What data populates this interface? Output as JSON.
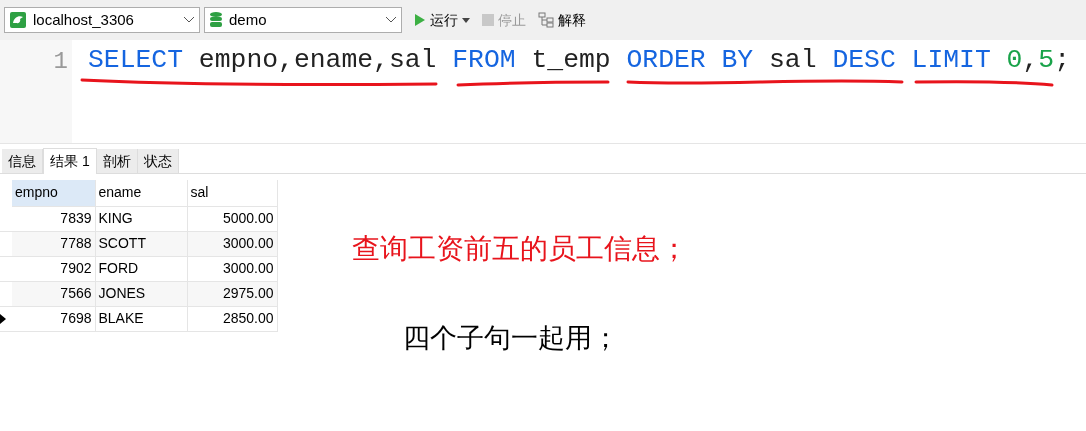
{
  "toolbar": {
    "connection": "localhost_3306",
    "database": "demo",
    "buttons": [
      {
        "label": "运行",
        "disabled": false,
        "kind": "run"
      },
      {
        "label": "停止",
        "disabled": true,
        "kind": "stop"
      },
      {
        "label": "解释",
        "disabled": false,
        "kind": "explain"
      }
    ]
  },
  "editor": {
    "line_number": "1",
    "tokens": [
      {
        "text": "SELECT",
        "kind": "keyword"
      },
      {
        "text": " empno,ename,sal ",
        "kind": "plain"
      },
      {
        "text": "FROM",
        "kind": "keyword"
      },
      {
        "text": " t_emp ",
        "kind": "plain"
      },
      {
        "text": "ORDER",
        "kind": "keyword"
      },
      {
        "text": " BY",
        "kind": "keyword"
      },
      {
        "text": " sal ",
        "kind": "plain"
      },
      {
        "text": "DESC",
        "kind": "keyword"
      },
      {
        "text": " LIMIT",
        "kind": "keyword"
      },
      {
        "text": " 0",
        "kind": "number"
      },
      {
        "text": ",",
        "kind": "plain"
      },
      {
        "text": "5",
        "kind": "number"
      },
      {
        "text": ";",
        "kind": "plain"
      }
    ]
  },
  "tabs": [
    {
      "label": "信息",
      "selected": false
    },
    {
      "label": "结果 1",
      "selected": true
    },
    {
      "label": "剖析",
      "selected": false
    },
    {
      "label": "状态",
      "selected": false
    }
  ],
  "table": {
    "columns": [
      {
        "label": "empno",
        "selected": true
      },
      {
        "label": "ename",
        "selected": false
      },
      {
        "label": "sal",
        "selected": false
      }
    ],
    "rows": [
      {
        "cells": [
          "7839",
          "KING",
          "5000.00"
        ],
        "current": false
      },
      {
        "cells": [
          "7788",
          "SCOTT",
          "3000.00"
        ],
        "current": false
      },
      {
        "cells": [
          "7902",
          "FORD",
          "3000.00"
        ],
        "current": false
      },
      {
        "cells": [
          "7566",
          "JONES",
          "2975.00"
        ],
        "current": false
      },
      {
        "cells": [
          "7698",
          "BLAKE",
          "2850.00"
        ],
        "current": true
      }
    ]
  },
  "annotations": [
    {
      "text": "查询工资前五的员工信息；",
      "color": "#e8141c"
    },
    {
      "text": "四个子句一起用；",
      "color": "#000000"
    }
  ]
}
